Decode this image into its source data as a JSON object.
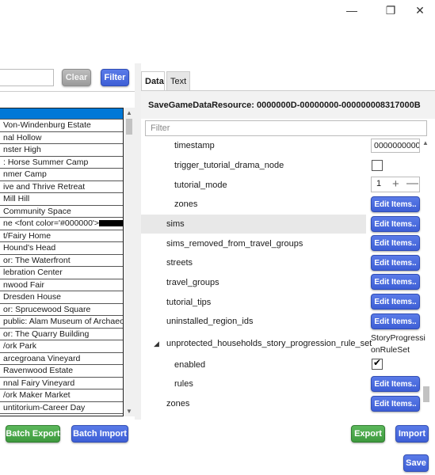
{
  "window": {
    "minimize_icon": "minimize-icon",
    "maximize_icon": "restore-icon",
    "close_icon": "close-icon",
    "minimize_glyph": "—",
    "maximize_glyph": "❐",
    "close_glyph": "✕"
  },
  "left": {
    "search_value": "",
    "clear_label": "Clear",
    "filter_label": "Filter",
    "items": [
      "",
      "Von-Windenburg Estate",
      "nal Hollow",
      "nster High",
      ": Horse Summer Camp",
      "nmer Camp",
      "ive and Thrive Retreat",
      "Mill Hill",
      "Community Space",
      "ne <font color='#000000'>",
      "t/Fairy Home",
      "Hound's Head",
      "or: The Waterfront",
      "lebration Center",
      "nwood Fair",
      "Dresden House",
      "or: Sprucewood Square",
      "public: Alam Museum of Archaeolo",
      "or: The Quarry Building",
      "/ork Park",
      "arcegroana Vineyard",
      "Ravenwood Estate",
      "nnal Fairy Vineyard",
      "/ork Maker Market",
      "untitorium-Career Day"
    ],
    "batch_export_label": "Batch Export",
    "batch_import_label": "Batch Import"
  },
  "tabs": {
    "data": "Data",
    "text": "Text"
  },
  "resource": {
    "title": "SaveGameDataResource: 0000000D-00000000-000000008317000B",
    "filter_placeholder": "Filter"
  },
  "tree": {
    "rows": [
      {
        "label": "timestamp"
      },
      {
        "label": "trigger_tutorial_drama_node"
      },
      {
        "label": "tutorial_mode"
      },
      {
        "label": "zones"
      },
      {
        "label": "sims"
      },
      {
        "label": "sims_removed_from_travel_groups"
      },
      {
        "label": "streets"
      },
      {
        "label": "travel_groups"
      },
      {
        "label": "tutorial_tips"
      },
      {
        "label": "uninstalled_region_ids"
      },
      {
        "label": "unprotected_households_story_progression_rule_set"
      },
      {
        "label": "enabled"
      },
      {
        "label": "rules"
      },
      {
        "label": "zones"
      }
    ],
    "expander_glyph": "◢"
  },
  "values": {
    "timestamp_value": "0000000000",
    "tutorial_mode_value": "1",
    "plus_glyph": "+",
    "minus_glyph": "—",
    "edit_items_label": "Edit Items..",
    "rule_set_line1": "StoryProgressi",
    "rule_set_line2": "onRuleSet",
    "enabled_checked": true
  },
  "footer": {
    "export_label": "Export",
    "import_label": "Import",
    "save_label": "Save"
  },
  "colors": {
    "blue_button": "#3e5fd6",
    "green_button": "#3e9a3e",
    "selection": "#0078d7"
  }
}
